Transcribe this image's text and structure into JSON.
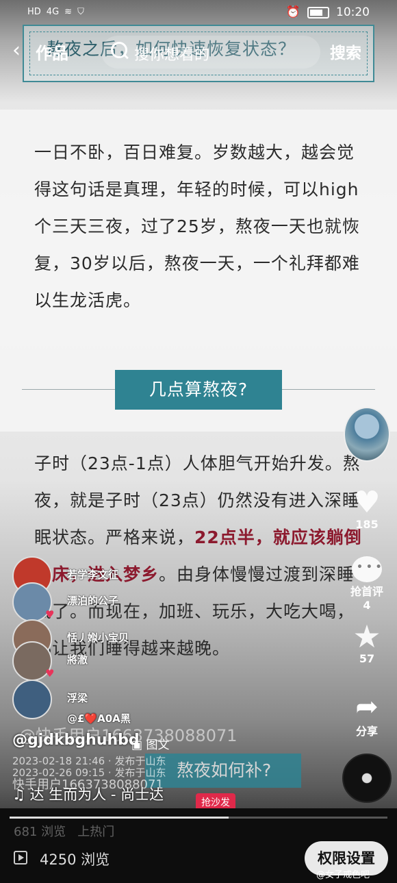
{
  "status_bar": {
    "left_indicators": [
      "HD",
      "4G"
    ],
    "time": "10:20"
  },
  "nav": {
    "back_icon": "chevron-left-icon",
    "title": "作品",
    "search_placeholder": "搜你想看的",
    "search_button": "搜索"
  },
  "article": {
    "title": "熬夜之后，如何快速恢复状态？",
    "para1": "一日不卧，百日难复。岁数越大，越会觉得这句话是真理，年轻的时候，可以high个三天三夜，过了25岁，熬夜一天也就恢复，30岁以后，熬夜一天，一个礼拜都难以生龙活虎。",
    "section1": "几点算熬夜?",
    "para2_before": "子时（23点-1点）人体胆气开始升发。熬夜，就是子时（23点）仍然没有进入深睡眠状态。严格来说，",
    "para2_highlight": "22点半，就应该躺倒在床，进入梦乡",
    "para2_after": "。由身体慢慢过渡到深睡眠了。而现在，加班、玩乐，大吃大喝，都让我们睡得越来越晚。",
    "section2": "熬夜如何补?"
  },
  "rail": {
    "like_count": "185",
    "comment_label": "抢首评",
    "comment_count": "4",
    "star_count": "57",
    "share_label": "分享"
  },
  "comments": [
    {
      "name": "若学李文征",
      "avatar_color": "#c0392b"
    },
    {
      "name": "漂泊的公子",
      "avatar_color": "#6b8aa8"
    },
    {
      "name": "恬丿娰小宝贝",
      "avatar_color": "#8a6b5a"
    },
    {
      "name": "將澈",
      "avatar_color": "#7a6a60"
    },
    {
      "name": "浮梁",
      "avatar_color": "#3f5f7f"
    },
    {
      "name": "@£❤️A0A黑",
      "avatar_color": "#6a7fa0"
    }
  ],
  "author": {
    "handle": "@gjdkbghuhbd",
    "ghost_handle": "@快手用户1663738088071",
    "post_type": "图文",
    "date1": "2023-02-18 21:46 · 发布于山东",
    "date2": "2023-02-26 09:15 · 发布于山东",
    "ghost_user": "快手用户1663738088071",
    "music": "达    生而为人 - 尚士达",
    "sofa_badge": "抢沙发"
  },
  "bottom_bar": {
    "views": "4250 浏览",
    "ghost_views": "681 浏览",
    "ghost_hot": "上热门",
    "permission_button": "权限设置",
    "progress": 0.58,
    "watermark": "@女子戒色吧"
  }
}
